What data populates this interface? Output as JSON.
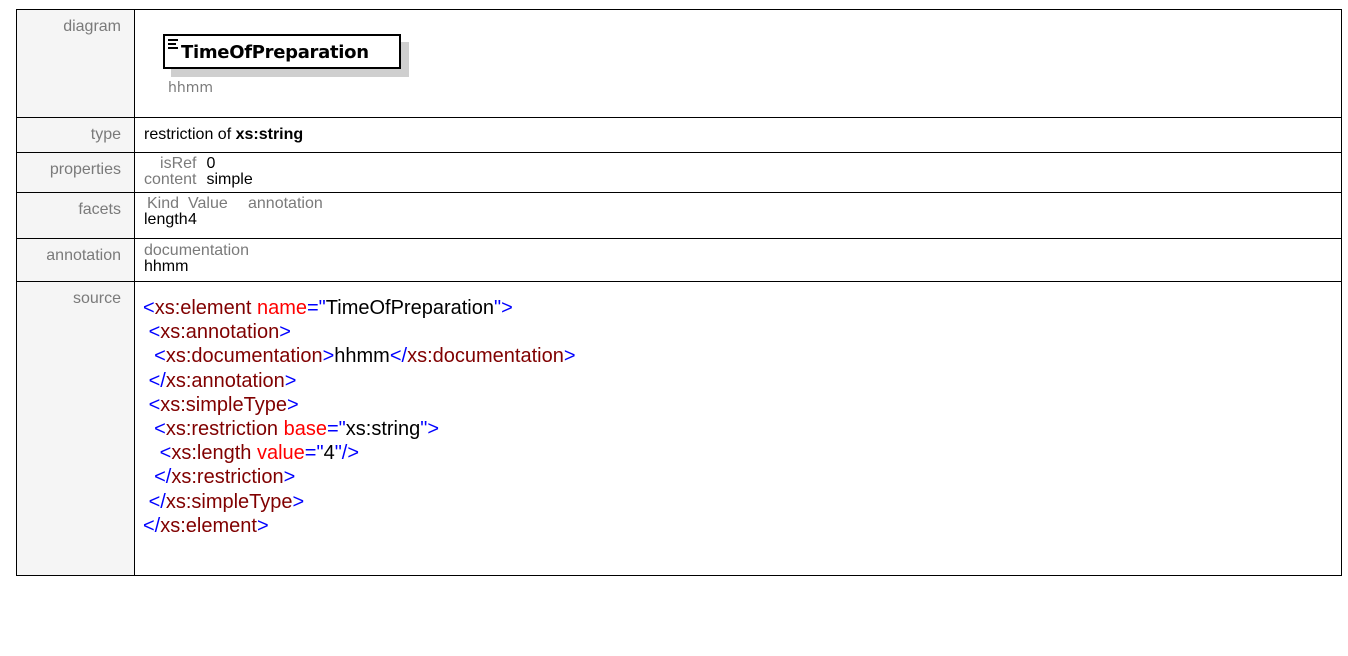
{
  "labels": {
    "diagram": "diagram",
    "type": "type",
    "properties": "properties",
    "facets": "facets",
    "annotation": "annotation",
    "source": "source"
  },
  "diagram": {
    "element_name": "TimeOfPreparation",
    "documentation": "hhmm"
  },
  "type": {
    "prefix": "restriction of ",
    "base": "xs:string"
  },
  "properties": [
    {
      "key": "isRef",
      "value": "0"
    },
    {
      "key": "content",
      "value": "simple"
    }
  ],
  "facets": {
    "headers": [
      "Kind",
      "Value",
      "annotation"
    ],
    "rows": [
      {
        "kind": "length",
        "value": "4",
        "annotation": ""
      }
    ]
  },
  "annotation": {
    "header": "documentation",
    "text": "hhmm"
  },
  "source_lines": [
    [
      [
        "tag",
        "<"
      ],
      [
        "tn",
        "xs:element"
      ],
      [
        "tx",
        " "
      ],
      [
        "an",
        "name"
      ],
      [
        "tag",
        "=\""
      ],
      [
        "av",
        "TimeOfPreparation"
      ],
      [
        "tag",
        "\">"
      ]
    ],
    [
      [
        "tx",
        " "
      ],
      [
        "tag",
        "<"
      ],
      [
        "tn",
        "xs:annotation"
      ],
      [
        "tag",
        ">"
      ]
    ],
    [
      [
        "tx",
        "  "
      ],
      [
        "tag",
        "<"
      ],
      [
        "tn",
        "xs:documentation"
      ],
      [
        "tag",
        ">"
      ],
      [
        "tx",
        "hhmm"
      ],
      [
        "tag",
        "</"
      ],
      [
        "tn",
        "xs:documentation"
      ],
      [
        "tag",
        ">"
      ]
    ],
    [
      [
        "tx",
        " "
      ],
      [
        "tag",
        "</"
      ],
      [
        "tn",
        "xs:annotation"
      ],
      [
        "tag",
        ">"
      ]
    ],
    [
      [
        "tx",
        " "
      ],
      [
        "tag",
        "<"
      ],
      [
        "tn",
        "xs:simpleType"
      ],
      [
        "tag",
        ">"
      ]
    ],
    [
      [
        "tx",
        "  "
      ],
      [
        "tag",
        "<"
      ],
      [
        "tn",
        "xs:restriction"
      ],
      [
        "tx",
        " "
      ],
      [
        "an",
        "base"
      ],
      [
        "tag",
        "=\""
      ],
      [
        "av",
        "xs:string"
      ],
      [
        "tag",
        "\">"
      ]
    ],
    [
      [
        "tx",
        "   "
      ],
      [
        "tag",
        "<"
      ],
      [
        "tn",
        "xs:length"
      ],
      [
        "tx",
        " "
      ],
      [
        "an",
        "value"
      ],
      [
        "tag",
        "=\""
      ],
      [
        "av",
        "4"
      ],
      [
        "tag",
        "\"/>"
      ]
    ],
    [
      [
        "tx",
        "  "
      ],
      [
        "tag",
        "</"
      ],
      [
        "tn",
        "xs:restriction"
      ],
      [
        "tag",
        ">"
      ]
    ],
    [
      [
        "tx",
        " "
      ],
      [
        "tag",
        "</"
      ],
      [
        "tn",
        "xs:simpleType"
      ],
      [
        "tag",
        ">"
      ]
    ],
    [
      [
        "tag",
        "</"
      ],
      [
        "tn",
        "xs:element"
      ],
      [
        "tag",
        ">"
      ]
    ]
  ],
  "colors": {
    "tag_bracket": "#0000ff",
    "tag_name": "#800000",
    "attr_name": "#ff0000",
    "label_gray": "#7a7a7a"
  }
}
